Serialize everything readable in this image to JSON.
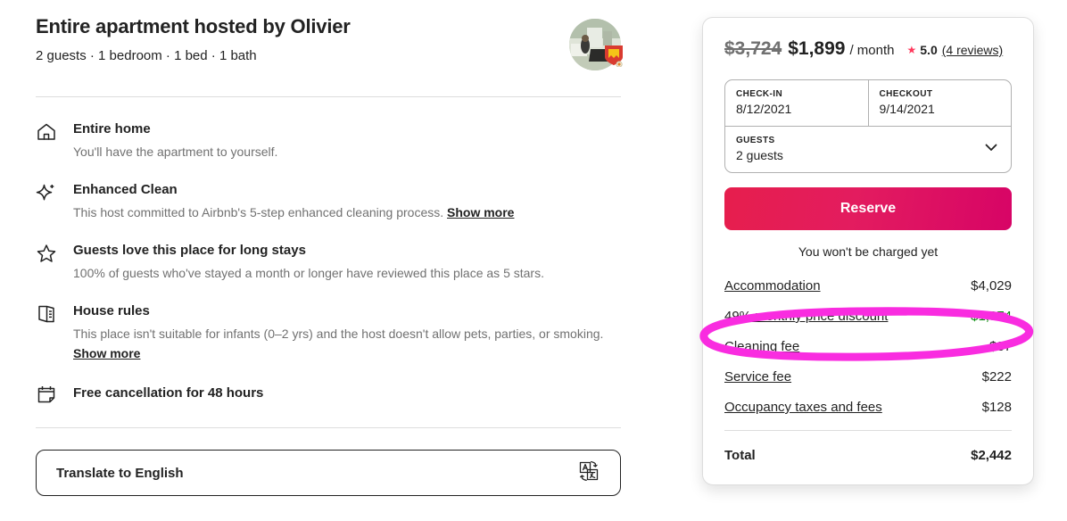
{
  "listing": {
    "title": "Entire apartment hosted by Olivier",
    "subtitle": "2 guests · 1 bedroom · 1 bed · 1 bath",
    "host_avatar_name": "host-avatar",
    "superhost_badge_name": "superhost-badge"
  },
  "features": [
    {
      "icon": "home-icon",
      "heading": "Entire home",
      "sub": "You'll have the apartment to yourself.",
      "show_more": ""
    },
    {
      "icon": "sparkle-icon",
      "heading": "Enhanced Clean",
      "sub": "This host committed to Airbnb's 5-step enhanced cleaning process.",
      "show_more": "Show more"
    },
    {
      "icon": "star-outline-icon",
      "heading": "Guests love this place for long stays",
      "sub": "100% of guests who've stayed a month or longer have reviewed this place as 5 stars.",
      "show_more": ""
    },
    {
      "icon": "house-rules-icon",
      "heading": "House rules",
      "sub": "This place isn't suitable for infants (0–2 yrs) and the host doesn't allow pets, parties, or smoking.",
      "show_more": "Show more"
    },
    {
      "icon": "calendar-icon",
      "heading": "Free cancellation for 48 hours",
      "sub": "",
      "show_more": ""
    }
  ],
  "translate": {
    "label": "Translate to English",
    "icon": "translate-icon"
  },
  "booking": {
    "price_old": "$3,724",
    "price_new": "$1,899",
    "price_unit": "/ month",
    "rating_star_icon": "star-filled-icon",
    "rating_value": "5.0",
    "reviews_link": "(4 reviews)",
    "checkin_label": "CHECK-IN",
    "checkin_value": "8/12/2021",
    "checkout_label": "CHECKOUT",
    "checkout_value": "9/14/2021",
    "guests_label": "GUESTS",
    "guests_value": "2 guests",
    "guests_chevron_icon": "chevron-down-icon",
    "reserve_label": "Reserve",
    "no_charge_note": "You won't be charged yet",
    "breakdown": [
      {
        "label": "Accommodation",
        "value": "$4,029",
        "highlighted": false
      },
      {
        "label": "49% monthly price discount",
        "value": "-$1,974",
        "highlighted": true
      },
      {
        "label": "Cleaning fee",
        "value": "$37",
        "highlighted": false
      },
      {
        "label": "Service fee",
        "value": "$222",
        "highlighted": false
      },
      {
        "label": "Occupancy taxes and fees",
        "value": "$128",
        "highlighted": false
      }
    ],
    "total_label": "Total",
    "total_value": "$2,442"
  },
  "annotation": {
    "type": "ellipse-highlight",
    "target": "49% monthly price discount",
    "color": "#f92ce0"
  },
  "colors": {
    "brand_red": "#ff385c",
    "reserve_gradient_start": "#e61e4d",
    "reserve_gradient_end": "#d70466",
    "discount_green": "#008a05",
    "annotation_magenta": "#f92ce0",
    "text_primary": "#222222",
    "text_secondary": "#717171",
    "border": "#dddddd"
  }
}
